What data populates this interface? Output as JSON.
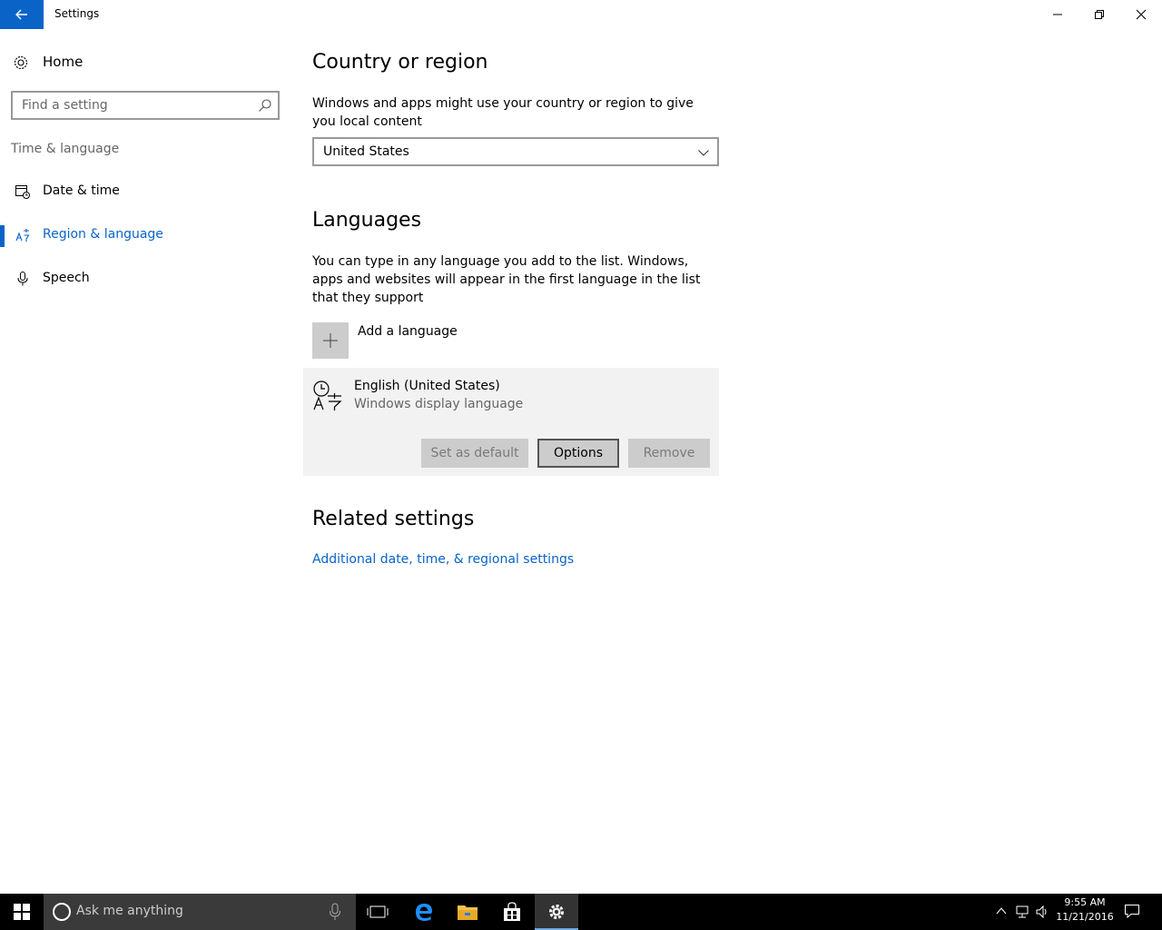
{
  "window": {
    "title": "Settings"
  },
  "sidebar": {
    "home_label": "Home",
    "search_placeholder": "Find a setting",
    "section_label": "Time & language",
    "items": [
      {
        "label": "Date & time",
        "icon": "calendar-clock-icon",
        "active": false
      },
      {
        "label": "Region & language",
        "icon": "region-language-icon",
        "active": true
      },
      {
        "label": "Speech",
        "icon": "microphone-icon",
        "active": false
      }
    ]
  },
  "main": {
    "country": {
      "heading": "Country or region",
      "description": "Windows and apps might use your country or region to give you local content",
      "selected": "United States"
    },
    "languages": {
      "heading": "Languages",
      "description": "You can type in any language you add to the list. Windows, apps and websites will appear in the first language in the list that they support",
      "add_label": "Add a language",
      "entry": {
        "name": "English (United States)",
        "subtitle": "Windows display language",
        "buttons": {
          "set_default": "Set as default",
          "options": "Options",
          "remove": "Remove"
        }
      }
    },
    "related": {
      "heading": "Related settings",
      "link": "Additional date, time, & regional settings"
    }
  },
  "taskbar": {
    "search_placeholder": "Ask me anything",
    "time": "9:55 AM",
    "date": "11/21/2016"
  },
  "colors": {
    "accent": "#0a64c8",
    "taskbar": "#000000"
  }
}
